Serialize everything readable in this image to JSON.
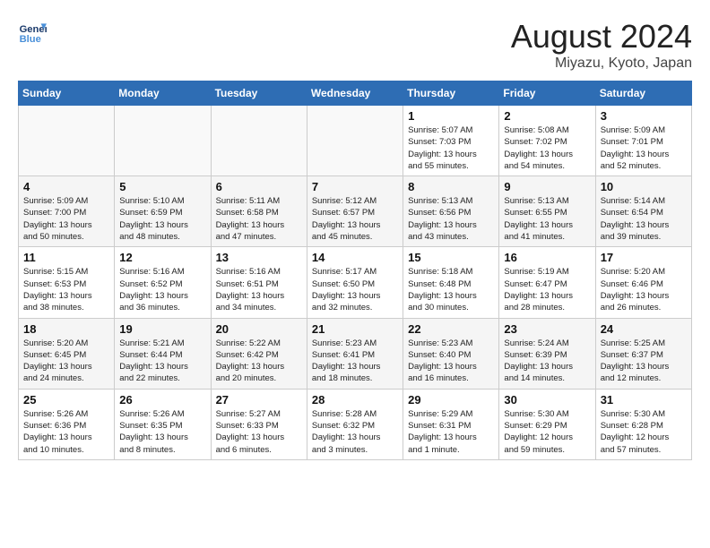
{
  "header": {
    "logo_line1": "General",
    "logo_line2": "Blue",
    "month_title": "August 2024",
    "location": "Miyazu, Kyoto, Japan"
  },
  "weekdays": [
    "Sunday",
    "Monday",
    "Tuesday",
    "Wednesday",
    "Thursday",
    "Friday",
    "Saturday"
  ],
  "weeks": [
    [
      {
        "day": "",
        "info": ""
      },
      {
        "day": "",
        "info": ""
      },
      {
        "day": "",
        "info": ""
      },
      {
        "day": "",
        "info": ""
      },
      {
        "day": "1",
        "info": "Sunrise: 5:07 AM\nSunset: 7:03 PM\nDaylight: 13 hours\nand 55 minutes."
      },
      {
        "day": "2",
        "info": "Sunrise: 5:08 AM\nSunset: 7:02 PM\nDaylight: 13 hours\nand 54 minutes."
      },
      {
        "day": "3",
        "info": "Sunrise: 5:09 AM\nSunset: 7:01 PM\nDaylight: 13 hours\nand 52 minutes."
      }
    ],
    [
      {
        "day": "4",
        "info": "Sunrise: 5:09 AM\nSunset: 7:00 PM\nDaylight: 13 hours\nand 50 minutes."
      },
      {
        "day": "5",
        "info": "Sunrise: 5:10 AM\nSunset: 6:59 PM\nDaylight: 13 hours\nand 48 minutes."
      },
      {
        "day": "6",
        "info": "Sunrise: 5:11 AM\nSunset: 6:58 PM\nDaylight: 13 hours\nand 47 minutes."
      },
      {
        "day": "7",
        "info": "Sunrise: 5:12 AM\nSunset: 6:57 PM\nDaylight: 13 hours\nand 45 minutes."
      },
      {
        "day": "8",
        "info": "Sunrise: 5:13 AM\nSunset: 6:56 PM\nDaylight: 13 hours\nand 43 minutes."
      },
      {
        "day": "9",
        "info": "Sunrise: 5:13 AM\nSunset: 6:55 PM\nDaylight: 13 hours\nand 41 minutes."
      },
      {
        "day": "10",
        "info": "Sunrise: 5:14 AM\nSunset: 6:54 PM\nDaylight: 13 hours\nand 39 minutes."
      }
    ],
    [
      {
        "day": "11",
        "info": "Sunrise: 5:15 AM\nSunset: 6:53 PM\nDaylight: 13 hours\nand 38 minutes."
      },
      {
        "day": "12",
        "info": "Sunrise: 5:16 AM\nSunset: 6:52 PM\nDaylight: 13 hours\nand 36 minutes."
      },
      {
        "day": "13",
        "info": "Sunrise: 5:16 AM\nSunset: 6:51 PM\nDaylight: 13 hours\nand 34 minutes."
      },
      {
        "day": "14",
        "info": "Sunrise: 5:17 AM\nSunset: 6:50 PM\nDaylight: 13 hours\nand 32 minutes."
      },
      {
        "day": "15",
        "info": "Sunrise: 5:18 AM\nSunset: 6:48 PM\nDaylight: 13 hours\nand 30 minutes."
      },
      {
        "day": "16",
        "info": "Sunrise: 5:19 AM\nSunset: 6:47 PM\nDaylight: 13 hours\nand 28 minutes."
      },
      {
        "day": "17",
        "info": "Sunrise: 5:20 AM\nSunset: 6:46 PM\nDaylight: 13 hours\nand 26 minutes."
      }
    ],
    [
      {
        "day": "18",
        "info": "Sunrise: 5:20 AM\nSunset: 6:45 PM\nDaylight: 13 hours\nand 24 minutes."
      },
      {
        "day": "19",
        "info": "Sunrise: 5:21 AM\nSunset: 6:44 PM\nDaylight: 13 hours\nand 22 minutes."
      },
      {
        "day": "20",
        "info": "Sunrise: 5:22 AM\nSunset: 6:42 PM\nDaylight: 13 hours\nand 20 minutes."
      },
      {
        "day": "21",
        "info": "Sunrise: 5:23 AM\nSunset: 6:41 PM\nDaylight: 13 hours\nand 18 minutes."
      },
      {
        "day": "22",
        "info": "Sunrise: 5:23 AM\nSunset: 6:40 PM\nDaylight: 13 hours\nand 16 minutes."
      },
      {
        "day": "23",
        "info": "Sunrise: 5:24 AM\nSunset: 6:39 PM\nDaylight: 13 hours\nand 14 minutes."
      },
      {
        "day": "24",
        "info": "Sunrise: 5:25 AM\nSunset: 6:37 PM\nDaylight: 13 hours\nand 12 minutes."
      }
    ],
    [
      {
        "day": "25",
        "info": "Sunrise: 5:26 AM\nSunset: 6:36 PM\nDaylight: 13 hours\nand 10 minutes."
      },
      {
        "day": "26",
        "info": "Sunrise: 5:26 AM\nSunset: 6:35 PM\nDaylight: 13 hours\nand 8 minutes."
      },
      {
        "day": "27",
        "info": "Sunrise: 5:27 AM\nSunset: 6:33 PM\nDaylight: 13 hours\nand 6 minutes."
      },
      {
        "day": "28",
        "info": "Sunrise: 5:28 AM\nSunset: 6:32 PM\nDaylight: 13 hours\nand 3 minutes."
      },
      {
        "day": "29",
        "info": "Sunrise: 5:29 AM\nSunset: 6:31 PM\nDaylight: 13 hours\nand 1 minute."
      },
      {
        "day": "30",
        "info": "Sunrise: 5:30 AM\nSunset: 6:29 PM\nDaylight: 12 hours\nand 59 minutes."
      },
      {
        "day": "31",
        "info": "Sunrise: 5:30 AM\nSunset: 6:28 PM\nDaylight: 12 hours\nand 57 minutes."
      }
    ]
  ]
}
